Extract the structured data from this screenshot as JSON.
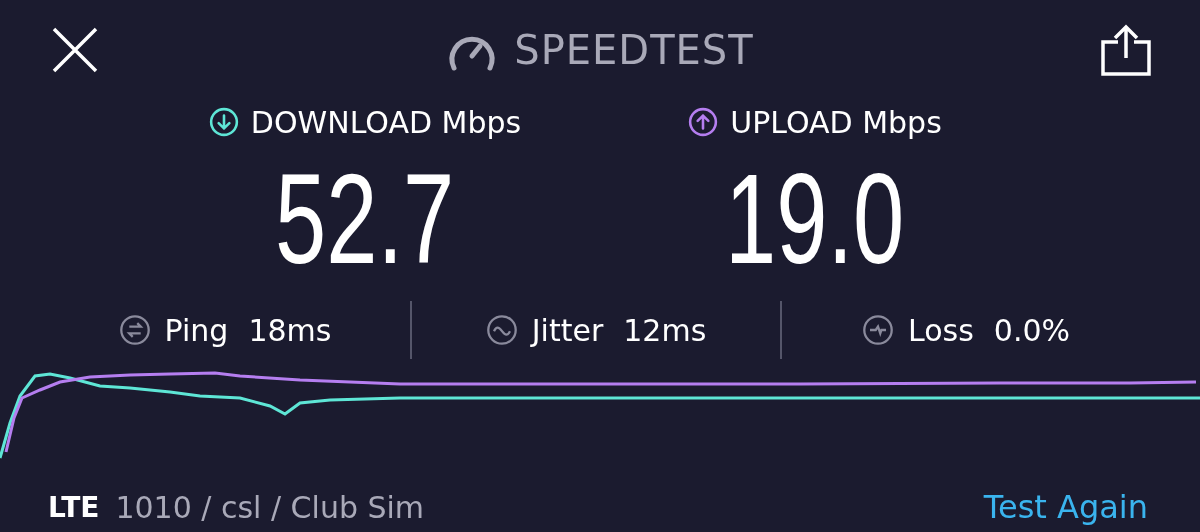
{
  "header": {
    "title": "SPEEDTEST"
  },
  "results": [
    {
      "kind": "download",
      "label": "DOWNLOAD Mbps",
      "value": "52.7",
      "color": "#5ee6d6"
    },
    {
      "kind": "upload",
      "label": "UPLOAD Mbps",
      "value": "19.0",
      "color": "#b57ef0"
    }
  ],
  "stats": [
    {
      "kind": "ping",
      "label": "Ping",
      "value": "18ms"
    },
    {
      "kind": "jitter",
      "label": "Jitter",
      "value": "12ms"
    },
    {
      "kind": "loss",
      "label": "Loss",
      "value": "0.0%"
    }
  ],
  "footer": {
    "network_type": "LTE",
    "carrier": "1010 / csl / Club Sim",
    "action": "Test Again"
  }
}
